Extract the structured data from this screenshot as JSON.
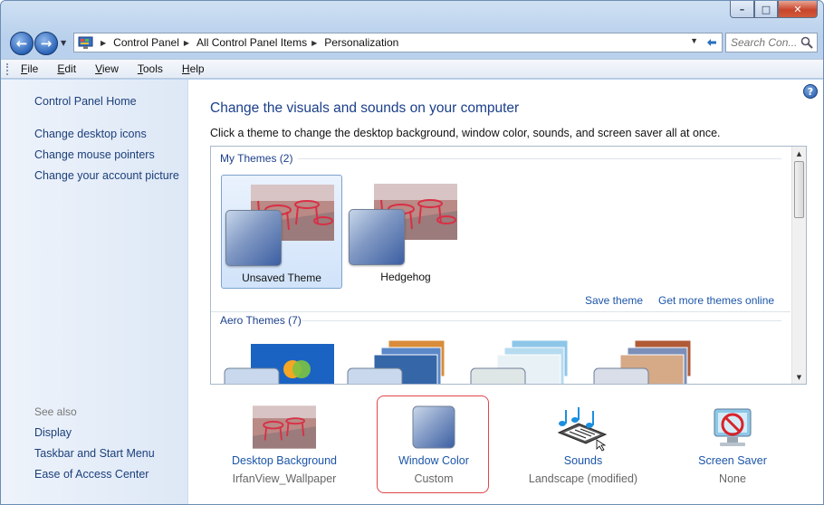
{
  "window": {
    "controls": {
      "minimize": "–",
      "maximize": "□",
      "close": "✕"
    }
  },
  "navigation": {
    "back_glyph": "←",
    "forward_glyph": "→",
    "breadcrumbs": [
      "Control Panel",
      "All Control Panel Items",
      "Personalization"
    ],
    "search_placeholder": "Search Con..."
  },
  "menu": {
    "items": [
      {
        "key": "F",
        "rest": "ile"
      },
      {
        "key": "E",
        "rest": "dit"
      },
      {
        "key": "V",
        "rest": "iew"
      },
      {
        "key": "T",
        "rest": "ools"
      },
      {
        "key": "H",
        "rest": "elp"
      }
    ]
  },
  "sidebar": {
    "home": "Control Panel Home",
    "links": [
      "Change desktop icons",
      "Change mouse pointers",
      "Change your account picture"
    ],
    "see_also_label": "See also",
    "see_also": [
      "Display",
      "Taskbar and Start Menu",
      "Ease of Access Center"
    ]
  },
  "main": {
    "title": "Change the visuals and sounds on your computer",
    "description": "Click a theme to change the desktop background, window color, sounds, and screen saver all at once.",
    "my_themes_label": "My Themes (2)",
    "my_themes": [
      {
        "name": "Unsaved Theme",
        "selected": true
      },
      {
        "name": "Hedgehog",
        "selected": false
      }
    ],
    "save_theme": "Save theme",
    "more_themes": "Get more themes online",
    "aero_themes_label": "Aero Themes (7)"
  },
  "bottom": {
    "desktop_background": {
      "title": "Desktop Background",
      "sub": "IrfanView_Wallpaper"
    },
    "window_color": {
      "title": "Window Color",
      "sub": "Custom"
    },
    "sounds": {
      "title": "Sounds",
      "sub": "Landscape (modified)"
    },
    "screen_saver": {
      "title": "Screen Saver",
      "sub": "None"
    }
  },
  "help_glyph": "?",
  "colors": {
    "link": "#1b55a8",
    "title": "#1b3f8b",
    "highlight": "#e0454a"
  }
}
